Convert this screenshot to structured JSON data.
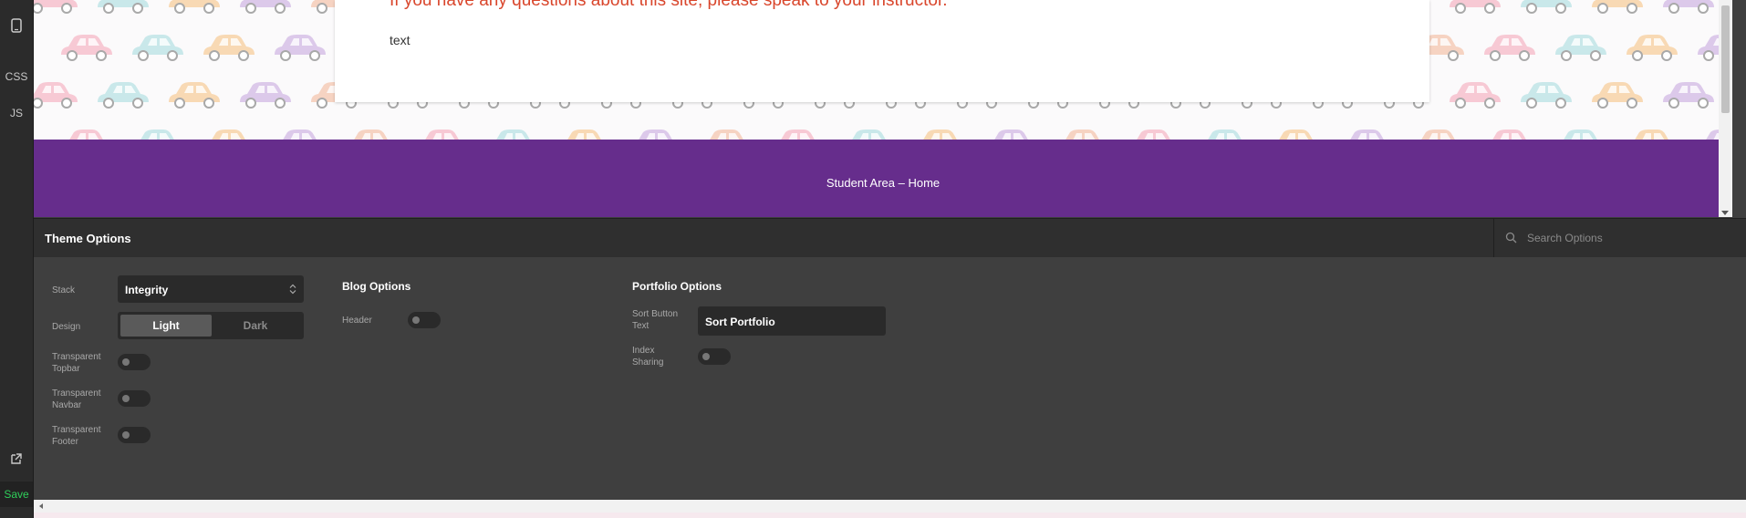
{
  "rail": {
    "css_label": "CSS",
    "js_label": "JS",
    "save_label": "Save"
  },
  "preview": {
    "message": "If you have any questions about this site, please speak to your instructor.",
    "text": "text",
    "footer_link": "Student Area – Home"
  },
  "panel": {
    "title": "Theme Options",
    "search_placeholder": "Search Options"
  },
  "stack": {
    "label": "Stack",
    "value": "Integrity"
  },
  "design": {
    "label": "Design",
    "options": [
      "Light",
      "Dark"
    ],
    "selected": "Light"
  },
  "toggles": {
    "transparent_topbar": "Transparent Topbar",
    "transparent_navbar": "Transparent Navbar",
    "transparent_footer": "Transparent Footer"
  },
  "blog": {
    "heading": "Blog Options",
    "header_label": "Header"
  },
  "portfolio": {
    "heading": "Portfolio Options",
    "sort_label": "Sort Button Text",
    "sort_value": "Sort Portfolio",
    "index_label": "Index Sharing"
  },
  "colors": {
    "footer_purple": "#662d8c",
    "save_green": "#2fcf5a",
    "message_red": "#d9462c"
  }
}
